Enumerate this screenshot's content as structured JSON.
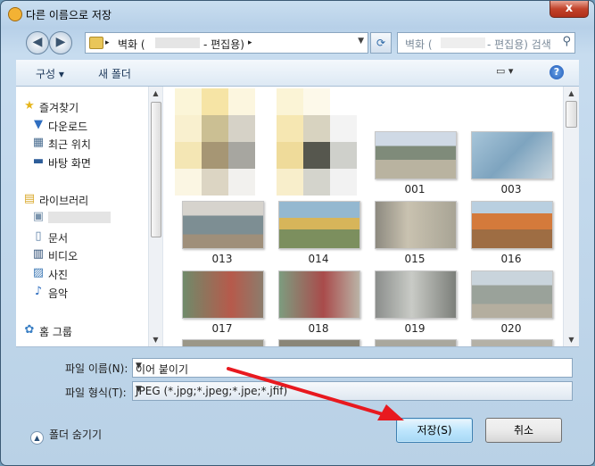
{
  "window": {
    "title": "다른 이름으로 저장",
    "close_label": "x"
  },
  "address": {
    "seg1": "벽화 (",
    "seg2": "- 편집용)",
    "sep": "▸"
  },
  "search": {
    "placeholder1": "벽화 (",
    "placeholder2": "- 편집용) 검색"
  },
  "toolbar": {
    "organize": "구성 ▾",
    "new_folder": "새 폴더",
    "help": "?"
  },
  "nav": {
    "favorites": "즐겨찾기",
    "downloads": "다운로드",
    "recent": "최근 위치",
    "desktop": "바탕 화면",
    "libraries": "라이브러리",
    "documents": "문서",
    "videos": "비디오",
    "pictures": "사진",
    "music": "음악",
    "homegroup": "홈 그룹"
  },
  "files": {
    "row1": [
      "001",
      "003"
    ],
    "row2": [
      "013",
      "014",
      "015",
      "016"
    ],
    "row3": [
      "017",
      "018",
      "019",
      "020"
    ]
  },
  "form": {
    "filename_label": "파일 이름(N):",
    "filename_value": "이어 붙이기",
    "filetype_label": "파일 형식(T):",
    "filetype_value": "JPEG (*.jpg;*.jpeg;*.jpe;*.jfif)"
  },
  "buttons": {
    "hide_folders": "폴더 숨기기",
    "save": "저장(S)",
    "cancel": "취소"
  },
  "colors": {
    "arrow": "#e8191f",
    "accent": "#3c7fb1"
  }
}
